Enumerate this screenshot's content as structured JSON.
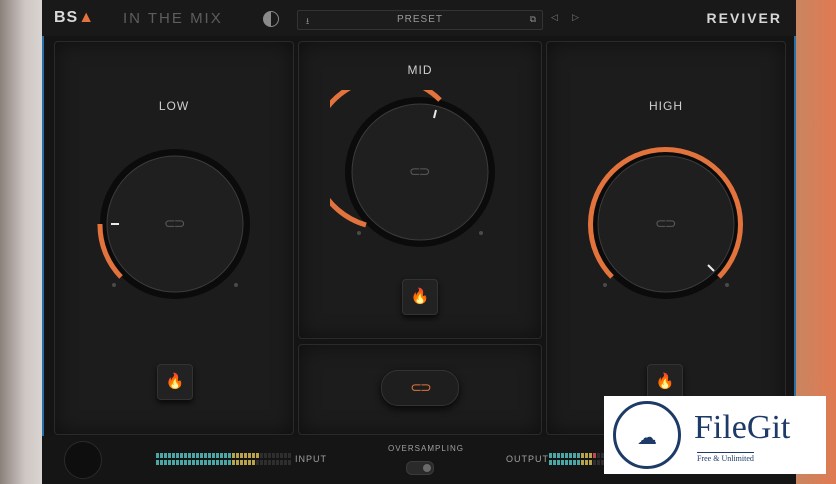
{
  "header": {
    "brand": "BS",
    "brand_mark": "▲",
    "plugin_name": "IN THE MIX",
    "preset_label": "PRESET",
    "prev_icon": "◁",
    "next_icon": "▷",
    "product_logo": "REVIVER"
  },
  "bands": {
    "low": {
      "label": "LOW",
      "value_fraction": 0.05
    },
    "mid": {
      "label": "MID",
      "value_fraction": 0.55
    },
    "high": {
      "label": "HIGH",
      "value_fraction": 0.92
    }
  },
  "link_icon": "⊂⊃",
  "flame_icon": "🔥",
  "footer": {
    "input_label": "INPUT",
    "output_label": "OUTPUT",
    "oversampling_label": "OVERSAMPLING"
  },
  "watermark": {
    "name": "FileGit",
    "tagline": "Free & Unlimited"
  },
  "colors": {
    "accent": "#e2733d",
    "background": "#141414",
    "panel": "#1c1c1c"
  }
}
